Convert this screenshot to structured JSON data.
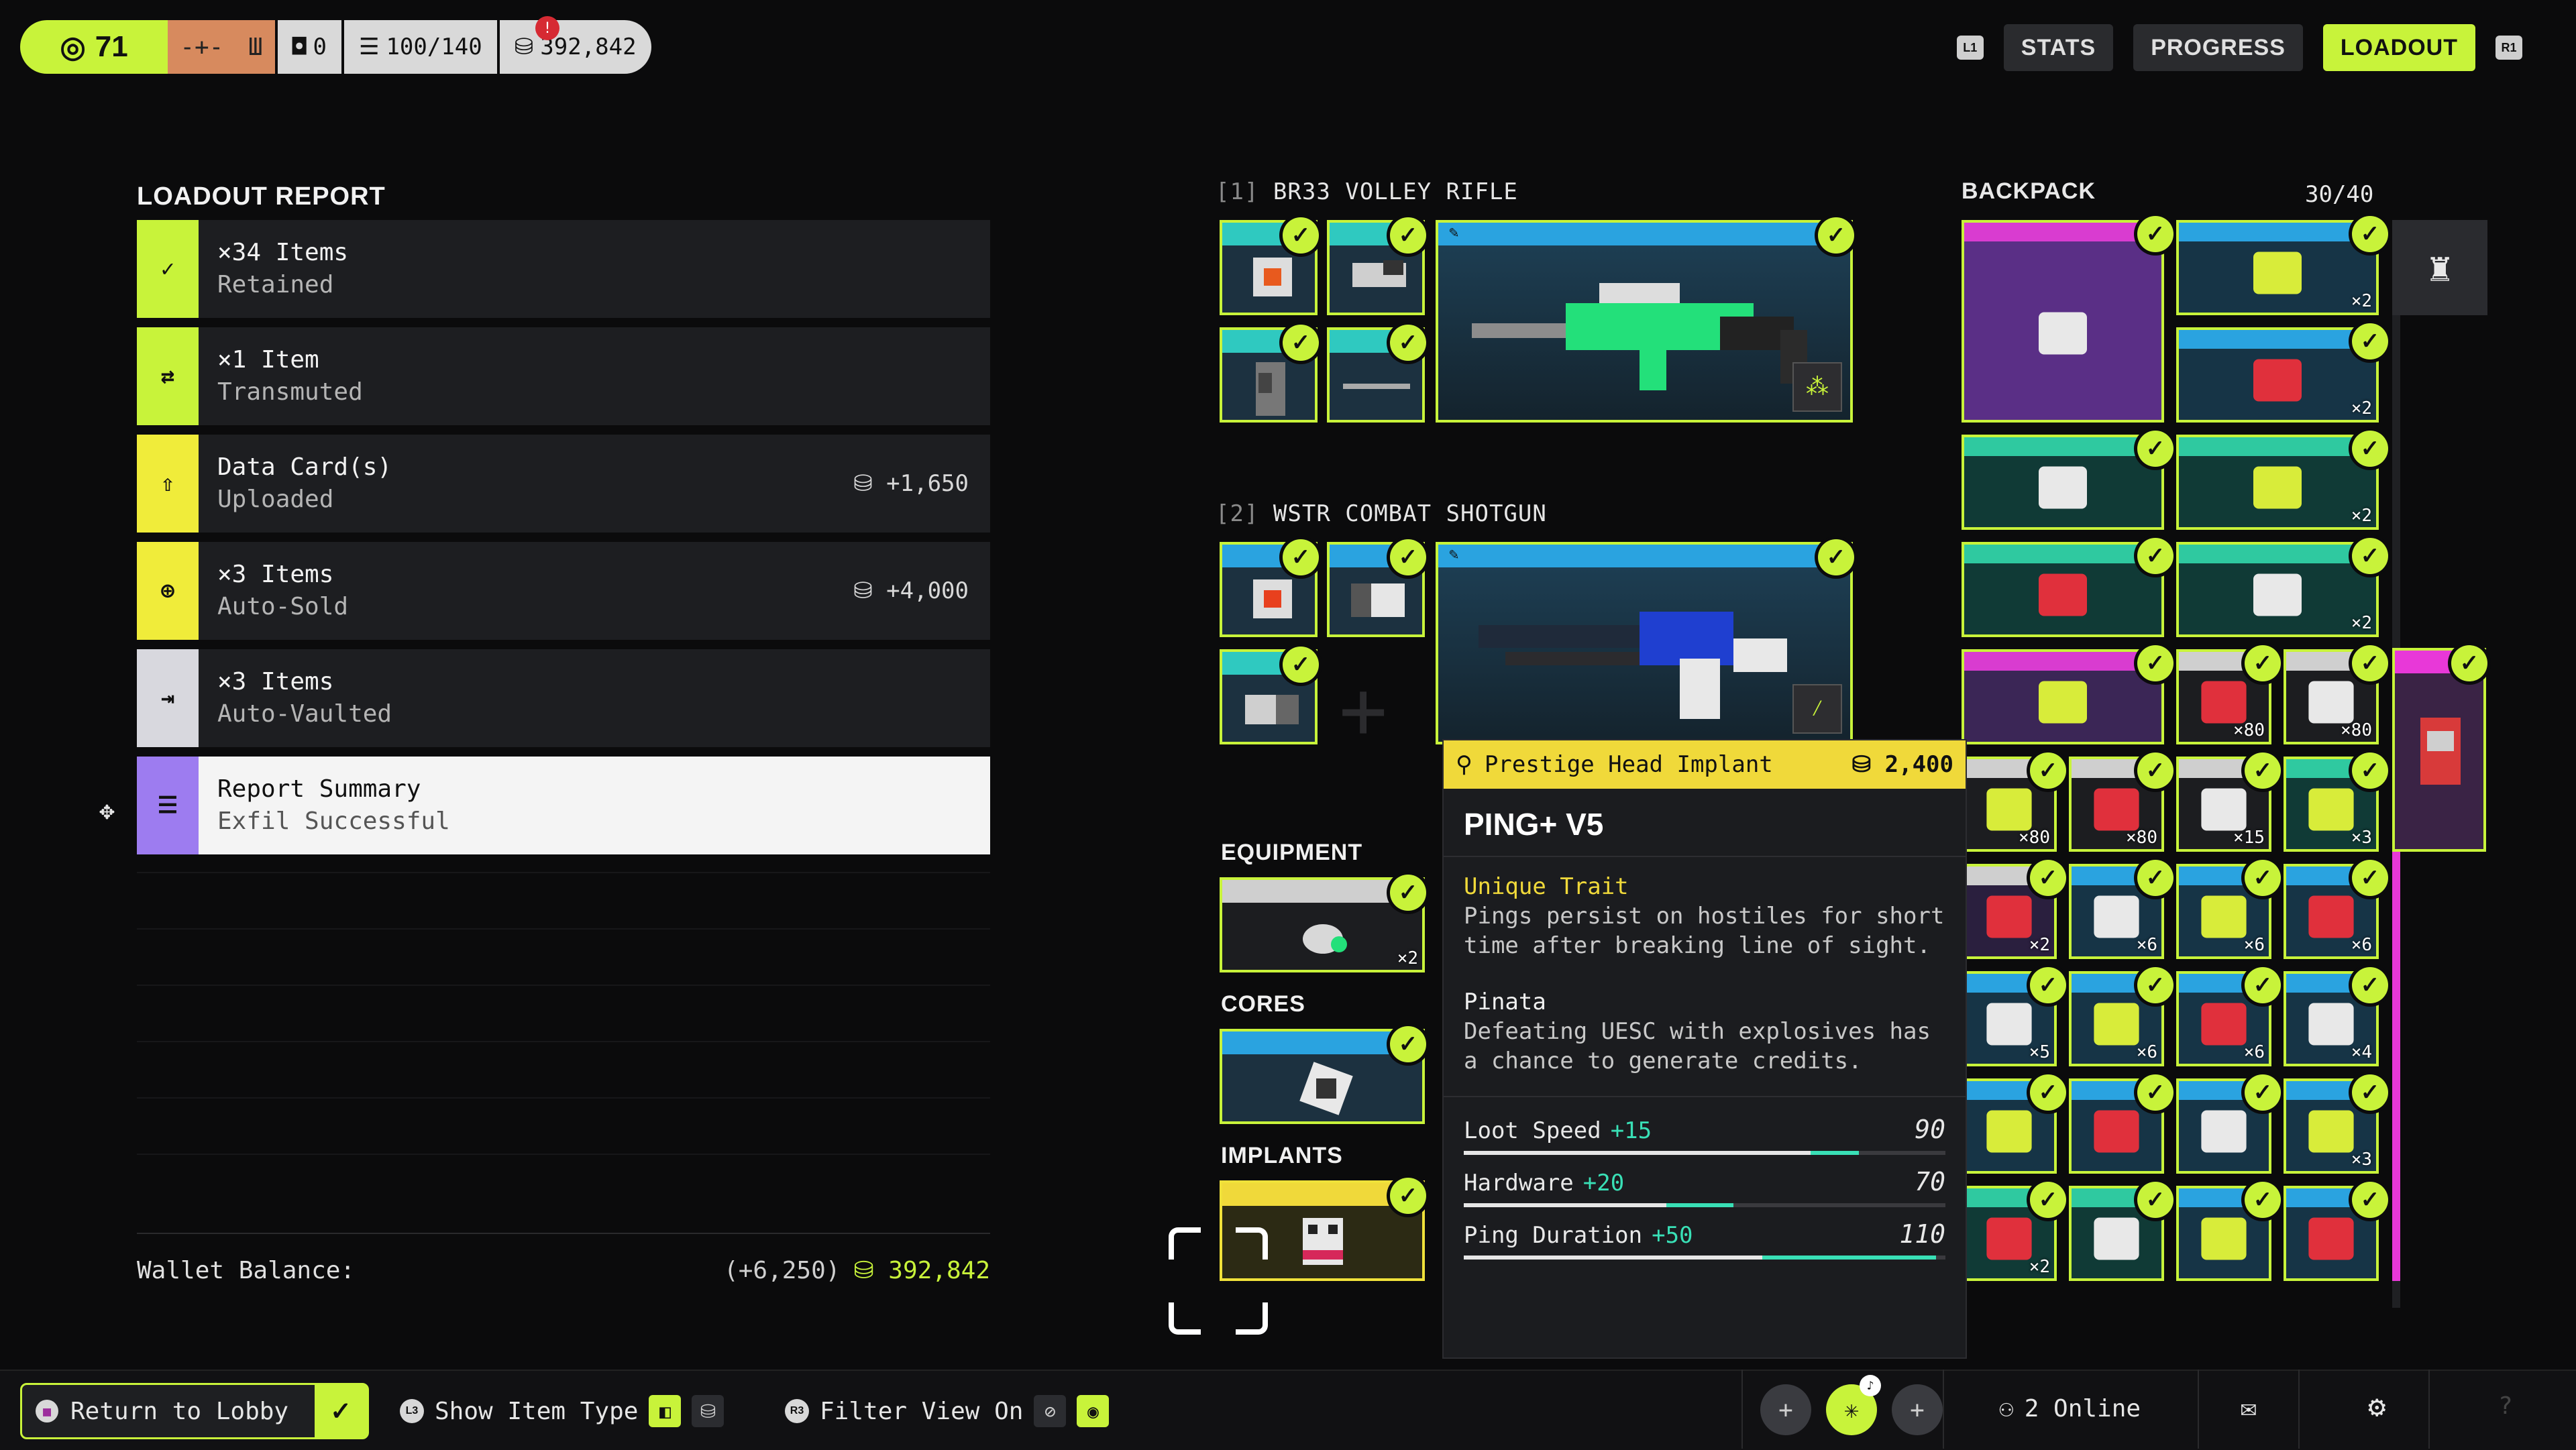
{
  "topbar": {
    "level": "71",
    "inventory_stash": "0",
    "capacity": "100/140",
    "credits": "392,842"
  },
  "nav": {
    "left_shoulder": "L1",
    "right_shoulder": "R1",
    "tabs": [
      "STATS",
      "PROGRESS",
      "LOADOUT"
    ],
    "active_tab": "LOADOUT"
  },
  "report": {
    "title": "LOADOUT REPORT",
    "rows": [
      {
        "line1": "×34 Items",
        "line2": "Retained",
        "amount": "",
        "color": "#c8f33a",
        "icon": "✓"
      },
      {
        "line1": "×1 Item",
        "line2": "Transmuted",
        "amount": "",
        "color": "#c8f33a",
        "icon": "⇄"
      },
      {
        "line1": "Data Card(s)",
        "line2": "Uploaded",
        "amount": "+1,650",
        "color": "#f0ec3a",
        "icon": "⇧"
      },
      {
        "line1": "×3 Items",
        "line2": "Auto-Sold",
        "amount": "+4,000",
        "color": "#f0ec3a",
        "icon": "⊕"
      },
      {
        "line1": "×3 Items",
        "line2": "Auto-Vaulted",
        "amount": "",
        "color": "#d8d8de",
        "icon": "⇥"
      },
      {
        "line1": "Report Summary",
        "line2": "Exfil Successful",
        "amount": "",
        "color": "#9d7cf0",
        "icon": "☰"
      }
    ],
    "wallet_label": "Wallet Balance:",
    "wallet_delta": "(+6,250)",
    "wallet_balance": "392,842"
  },
  "weapons": [
    {
      "index": "[1]",
      "name": "BR33 VOLLEY RIFLE"
    },
    {
      "index": "[2]",
      "name": "WSTR COMBAT SHOTGUN"
    }
  ],
  "sections": {
    "equipment": "EQUIPMENT",
    "equipment_qty": "×2",
    "cores": "CORES",
    "implants": "IMPLANTS"
  },
  "backpack": {
    "title": "BACKPACK",
    "count": "30/40",
    "cells": [
      {
        "qty": "",
        "bg": "#5a2f86",
        "tag": "#d93cd0"
      },
      {
        "qty": "×2",
        "bg": "#163446",
        "tag": "#2aa3e0"
      },
      {
        "qty": "×2",
        "bg": "#163446",
        "tag": "#2aa3e0"
      },
      {
        "qty": "",
        "bg": "#103a36",
        "tag": "#2fc9a0"
      },
      {
        "qty": "×2",
        "bg": "#103a36",
        "tag": "#2fc9a0"
      },
      {
        "qty": "",
        "bg": "#103a36",
        "tag": "#2fc9a0"
      },
      {
        "qty": "×2",
        "bg": "#103a36",
        "tag": "#2fc9a0"
      },
      {
        "qty": "",
        "bg": "#3b2656",
        "tag": "#d93cd0"
      },
      {
        "qty": "×80",
        "bg": "#1c1d20",
        "tag": "#cfcfcf"
      },
      {
        "qty": "×80",
        "bg": "#1c1d20",
        "tag": "#cfcfcf"
      },
      {
        "qty": "×80",
        "bg": "#1c1d20",
        "tag": "#cfcfcf"
      },
      {
        "qty": "×80",
        "bg": "#1c1d20",
        "tag": "#cfcfcf"
      },
      {
        "qty": "×15",
        "bg": "#1c1d20",
        "tag": "#cfcfcf"
      },
      {
        "qty": "×3",
        "bg": "#103a36",
        "tag": "#2fc9a0"
      },
      {
        "qty": "×2",
        "bg": "#2a1f3e",
        "tag": "#cfcfcf"
      },
      {
        "qty": "×6",
        "bg": "#163446",
        "tag": "#2aa3e0"
      },
      {
        "qty": "×6",
        "bg": "#163446",
        "tag": "#2aa3e0"
      },
      {
        "qty": "×6",
        "bg": "#163446",
        "tag": "#2aa3e0"
      },
      {
        "qty": "×5",
        "bg": "#163446",
        "tag": "#2aa3e0"
      },
      {
        "qty": "×6",
        "bg": "#163446",
        "tag": "#2aa3e0"
      },
      {
        "qty": "×6",
        "bg": "#163446",
        "tag": "#2aa3e0"
      },
      {
        "qty": "×4",
        "bg": "#163446",
        "tag": "#2aa3e0"
      },
      {
        "qty": "",
        "bg": "#163446",
        "tag": "#2aa3e0"
      },
      {
        "qty": "",
        "bg": "#163446",
        "tag": "#2aa3e0"
      },
      {
        "qty": "",
        "bg": "#163446",
        "tag": "#2aa3e0"
      },
      {
        "qty": "×3",
        "bg": "#163446",
        "tag": "#2aa3e0"
      },
      {
        "qty": "×2",
        "bg": "#103a36",
        "tag": "#2fc9a0"
      },
      {
        "qty": "",
        "bg": "#103a36",
        "tag": "#2fc9a0"
      },
      {
        "qty": "",
        "bg": "#163446",
        "tag": "#2aa3e0"
      },
      {
        "qty": "",
        "bg": "#163446",
        "tag": "#2aa3e0"
      }
    ]
  },
  "tooltip": {
    "category": "Prestige Head Implant",
    "price": "2,400",
    "title": "PING+ V5",
    "trait_label": "Unique Trait",
    "trait_desc": "Pings persist on hostiles for short time after breaking line of sight.",
    "perk_name": "Pinata",
    "perk_desc": "Defeating UESC with explosives has a chance to generate credits.",
    "stats": [
      {
        "name": "Loot Speed",
        "bonus": "+15",
        "value": "90",
        "base": 0.72,
        "total": 0.82
      },
      {
        "name": "Hardware",
        "bonus": "+20",
        "value": "70",
        "base": 0.42,
        "total": 0.56
      },
      {
        "name": "Ping Duration",
        "bonus": "+50",
        "value": "110",
        "base": 0.62,
        "total": 0.98
      }
    ]
  },
  "bottom": {
    "return_label": "Return to Lobby",
    "show_item_type": "Show Item Type",
    "show_item_button": "L3",
    "filter_view": "Filter View On",
    "filter_button": "R3",
    "online": "2 Online"
  }
}
